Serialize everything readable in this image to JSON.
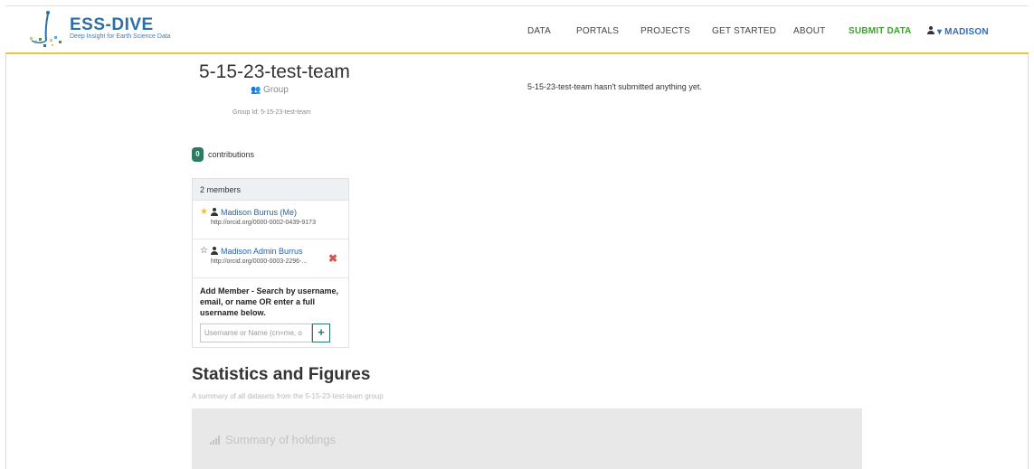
{
  "header": {
    "logo_text": "ESS-DIVE",
    "logo_tagline": "Deep Insight for Earth Science Data",
    "nav": [
      "DATA",
      "PORTALS",
      "PROJECTS",
      "GET STARTED",
      "ABOUT"
    ],
    "submit_label": "SUBMIT DATA",
    "user_label": "▾ MADISON",
    "colors": {
      "accent_border": "#e8c547",
      "submit": "#3d9f2f",
      "user": "#2b6fc2"
    }
  },
  "group": {
    "title": "5-15-23-test-team",
    "type": "Group",
    "id_label": "Group Id: 5-15-23-test-team",
    "empty_message": "5-15-23-test-team hasn't submitted anything yet."
  },
  "contributions": {
    "count": "0",
    "label": "contributions"
  },
  "members": {
    "header": "2 members",
    "list": [
      {
        "name": "Madison Burrus (Me)",
        "orcid": "http://orcid.org/0000-0002-0439-9173",
        "starred": true
      },
      {
        "name": "Madison Admin Burrus",
        "orcid": "http://orcid.org/0000-0003-2296-...",
        "starred": false
      }
    ],
    "add_label": "Add Member - Search by username, email, or name OR enter a full username below.",
    "add_placeholder": "Username or Name (cn=me, o",
    "add_button": "+"
  },
  "stats": {
    "title": "Statistics and Figures",
    "subtitle": "A summary of all datasets from the 5-15-23-test-team group",
    "summary_label": "Summary of holdings"
  }
}
